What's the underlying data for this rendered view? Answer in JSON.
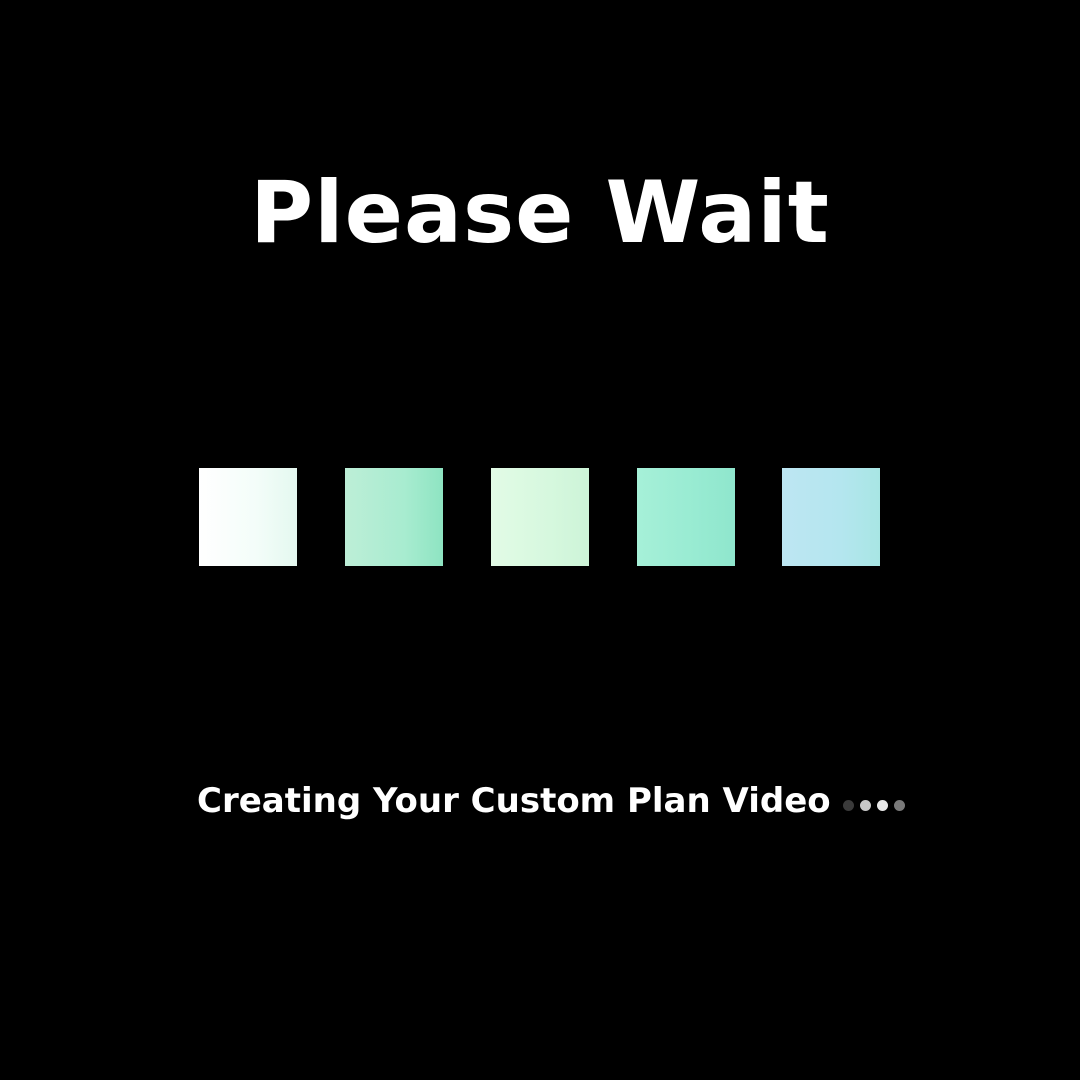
{
  "title": "Please Wait",
  "loader": {
    "squares": [
      {
        "color": "#f3fdf9"
      },
      {
        "color": "#a8ecd0"
      },
      {
        "color": "#d6f8de"
      },
      {
        "color": "#98ebd2"
      },
      {
        "color": "#b4e6ef"
      }
    ]
  },
  "status": {
    "text": "Creating Your Custom Plan Video",
    "dots": [
      {
        "color": "#3a3a3a"
      },
      {
        "color": "#c8c8c8"
      },
      {
        "color": "#e8e8e8"
      },
      {
        "color": "#7a7a7a"
      }
    ]
  },
  "colors": {
    "background": "#000000",
    "text": "#ffffff"
  }
}
